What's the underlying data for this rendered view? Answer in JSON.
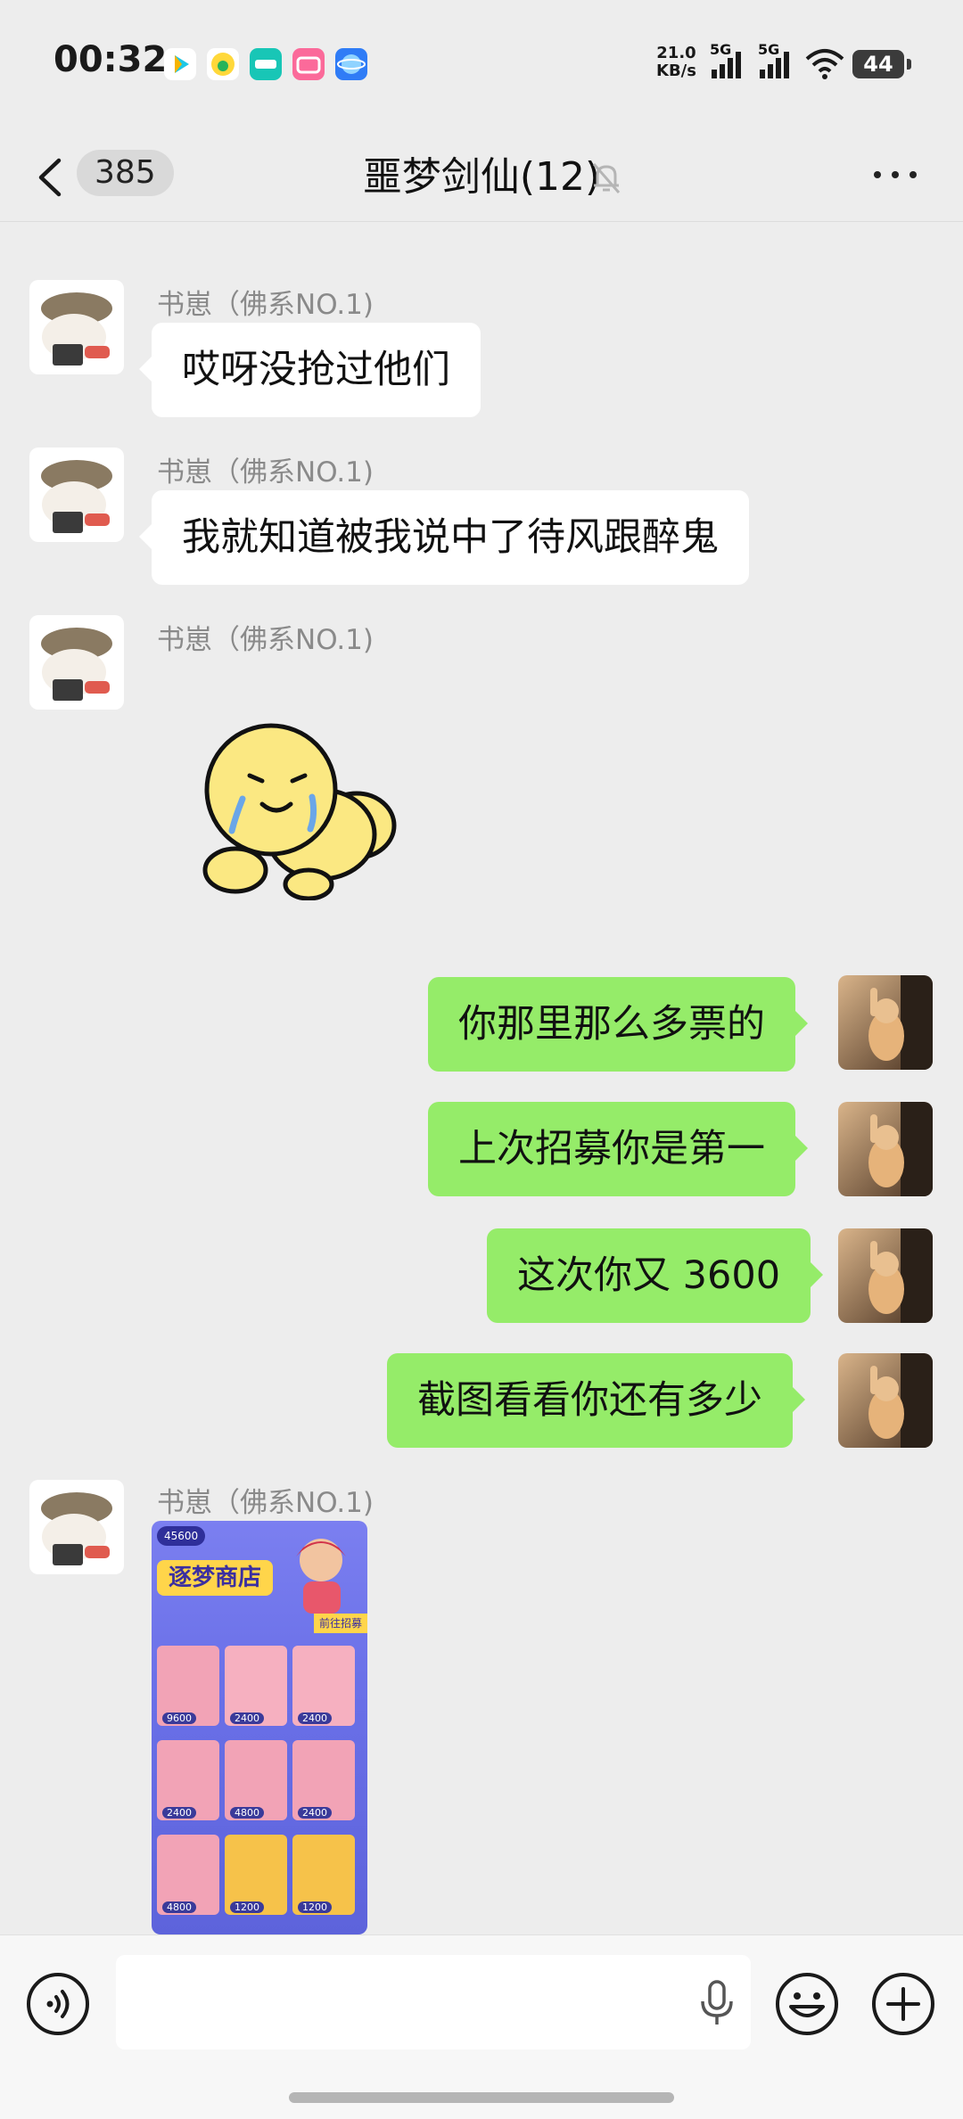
{
  "status_bar": {
    "time": "00:32",
    "net_speed_value": "21.0",
    "net_speed_unit": "KB/s",
    "signal1": "5G",
    "signal2": "5G",
    "battery": "44",
    "app_icons": [
      "tencent-video-icon",
      "qq-music-icon",
      "taptap-icon",
      "bilibili-icon",
      "qq-browser-icon"
    ]
  },
  "header": {
    "unread_count": "385",
    "title": "噩梦剑仙(12)"
  },
  "messages": [
    {
      "direction": "in",
      "sender": "书崽（佛系NO.1)",
      "text": "哎呀没抢过他们"
    },
    {
      "direction": "in",
      "sender": "书崽（佛系NO.1)",
      "text": "我就知道被我说中了待风跟醉鬼"
    },
    {
      "direction": "in",
      "sender": "书崽（佛系NO.1)",
      "type": "sticker"
    },
    {
      "direction": "out",
      "text": "你那里那么多票的"
    },
    {
      "direction": "out",
      "text": "上次招募你是第一"
    },
    {
      "direction": "out",
      "text": "这次你又 3600"
    },
    {
      "direction": "out",
      "text": "截图看看你还有多少"
    },
    {
      "direction": "in",
      "sender": "书崽（佛系NO.1)",
      "type": "image"
    }
  ],
  "shop_image": {
    "coins": "45600",
    "title": "逐梦商店",
    "tag": "前往招募",
    "prices": [
      "9600",
      "2400",
      "2400",
      "2400",
      "4800",
      "2400",
      "4800",
      "1200",
      "1200"
    ]
  },
  "colors": {
    "background": "#ededed",
    "outgoing_bubble": "#95ec69",
    "incoming_bubble": "#ffffff"
  }
}
